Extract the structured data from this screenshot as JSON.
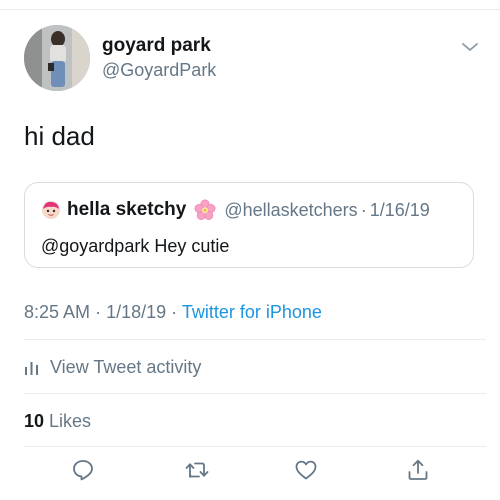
{
  "tweet": {
    "author": {
      "display_name": "goyard park",
      "handle": "@GoyardPark",
      "avatar_icon": "user-photo-avatar"
    },
    "text": "hi dad",
    "timestamp": "8:25 AM",
    "date": "1/18/19",
    "separator": "·",
    "source": "Twitter for iPhone",
    "source_color": "#1b95e0"
  },
  "quoted_tweet": {
    "display_name": "hella sketchy",
    "name_emoji": "cherry-blossom-icon",
    "handle": "@hellasketchers",
    "separator": "·",
    "date": "1/16/19",
    "text": "@goyardpark Hey cutie"
  },
  "activity": {
    "label": "View Tweet activity",
    "icon": "bar-chart-icon"
  },
  "likes": {
    "count": "10",
    "label": "Likes"
  },
  "actions": {
    "reply_icon": "reply-icon",
    "retweet_icon": "retweet-icon",
    "like_icon": "heart-icon",
    "share_icon": "share-icon"
  },
  "colors": {
    "text_primary": "#14171a",
    "text_secondary": "#657786",
    "border": "#e6ecf0",
    "link": "#1b95e0"
  }
}
